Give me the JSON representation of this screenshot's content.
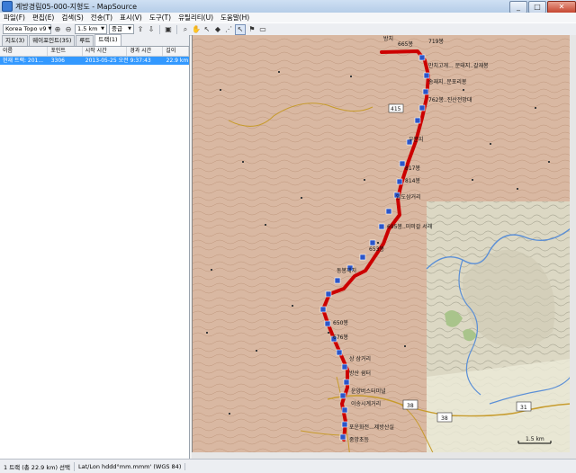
{
  "window": {
    "title": "계방경림05-000-지형도 - MapSource"
  },
  "menu": [
    "파일(F)",
    "편집(E)",
    "검색(S)",
    "전송(T)",
    "표시(V)",
    "도구(T)",
    "유틸리티(U)",
    "도움말(H)"
  ],
  "toolbar": {
    "map_product": "Korea Topo v9",
    "zoom_scale": "1.5 km",
    "detail_level": "중급"
  },
  "panel": {
    "tabs": [
      "지도(3)",
      "웨이포인트(35)",
      "루트",
      "트랙(1)"
    ],
    "active_tab": "트랙(1)",
    "columns": [
      "이름",
      "포인트",
      "시작 시간",
      "경과 시간",
      "길이"
    ],
    "rows": [
      {
        "name": "현재 트랙: 201...",
        "points": "3306",
        "start": "2013-05-25 오전",
        "elapsed": "9:37:43",
        "length": "22.9 km"
      }
    ]
  },
  "map": {
    "labels": {
      "peak_top": "방치",
      "peak_665": "665봉",
      "peak_719": "719봉",
      "wp_1": "만치고개... 문태지..갈재봉",
      "wp_2": "송재지..문포리봉",
      "wp_3": "762봉..진산전망대",
      "wp_4": "우분지",
      "wp_5": "817봉",
      "wp_6": "814봉",
      "wp_7": "임도삼거리",
      "wp_8": "695봉..미미갈 서래",
      "wp_9": "653봉",
      "wp_10": "동봉재치",
      "wp_11": "650봉",
      "wp_12": "676봉",
      "wp_13": "상 삼거리",
      "wp_14": "방산 쉼터",
      "wp_15": "운양버스터미널",
      "wp_16": "이송시계거리",
      "wp_17": "포운화전...제방산실",
      "wp_18": "중앙초등",
      "road_415": "415",
      "road_38a": "38",
      "road_38b": "38",
      "road_31": "31",
      "scale": "1.5 km"
    },
    "colors": {
      "track": "#cc0000",
      "waypoint": "#2b55c9",
      "terrain": "#d9b8a2",
      "relief": "#d8d5c2"
    }
  },
  "status": {
    "selection": "1 트랙 (총 22.9 km) 선택",
    "position_format": "Lat/Lon hddd°mm.mmm' (WGS 84)"
  }
}
